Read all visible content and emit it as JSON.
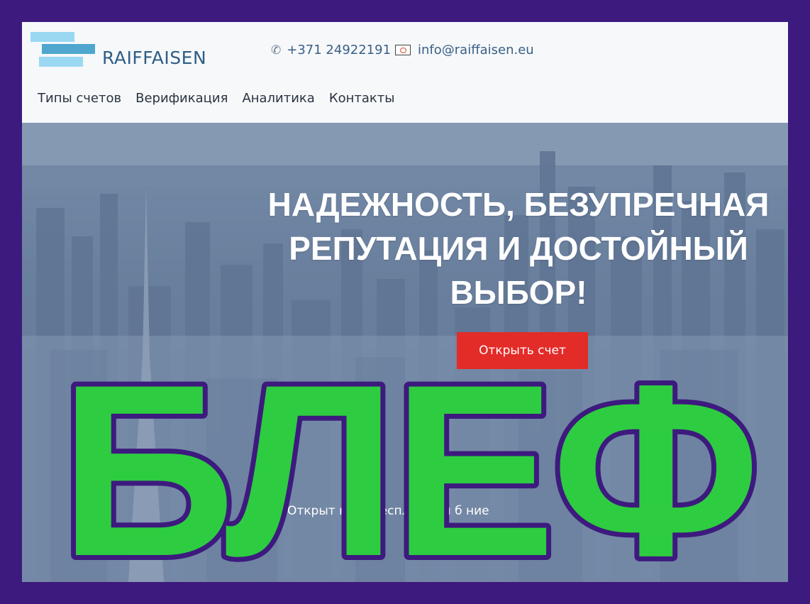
{
  "header": {
    "logo_text": "RAIFFAISEN",
    "phone": "+371 24922191",
    "email": "info@raiffaisen.eu",
    "icons": {
      "phone": "phone-icon",
      "email": "mail-icon"
    },
    "colors": {
      "logo_bar_light": "#9ad8f2",
      "logo_bar_dark": "#4fa7cf",
      "logo_text": "#2f5e86"
    }
  },
  "nav": {
    "items": [
      {
        "label": "Типы счетов"
      },
      {
        "label": "Верификация"
      },
      {
        "label": "Аналитика"
      },
      {
        "label": "Контакты"
      }
    ]
  },
  "hero": {
    "headline_line1": "НАДЕЖНОСТЬ, БЕЗУПРЕЧНАЯ",
    "headline_line2": "РЕПУТАЦИЯ И ДОСТОЙНЫЙ",
    "headline_line3": "ВЫБОР!",
    "cta_label": "Открыть счет",
    "subline": "Открыт          нас        , бесплатно и б                                 ние",
    "cta_color": "#e32b28"
  },
  "stamp": {
    "text": "БЛЕФ",
    "fill": "#2ecc40",
    "outline": "#3d1a7e"
  },
  "frame_color": "#3d1a7e"
}
